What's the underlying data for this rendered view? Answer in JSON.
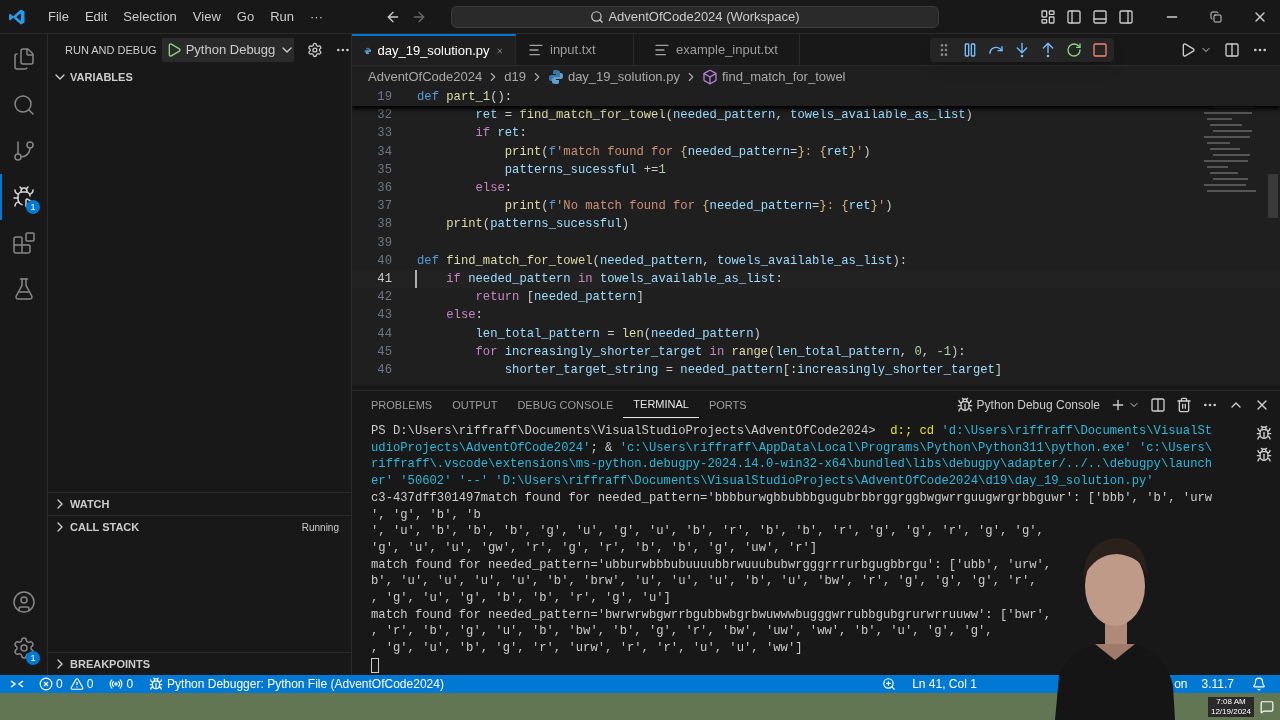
{
  "title_bar": {
    "menu": [
      "File",
      "Edit",
      "Selection",
      "View",
      "Go",
      "Run",
      "···"
    ],
    "search": "AdventOfCode2024 (Workspace)"
  },
  "activity_bar": [
    {
      "kind": "files",
      "selected": false
    },
    {
      "kind": "search",
      "selected": false
    },
    {
      "kind": "source",
      "selected": false
    },
    {
      "kind": "debug",
      "selected": true,
      "badge": "1"
    },
    {
      "kind": "extensions",
      "selected": false
    },
    {
      "kind": "testing",
      "selected": false
    }
  ],
  "activity_bottom": [
    {
      "kind": "account"
    },
    {
      "kind": "settings",
      "badge": "1"
    }
  ],
  "sidebar": {
    "title": "RUN AND DEBUG",
    "config": "Python Debugg",
    "sections": [
      {
        "label": "VARIABLES",
        "expanded": true
      },
      {
        "label": "WATCH",
        "expanded": false
      },
      {
        "label": "CALL STACK",
        "expanded": false,
        "status": "Running"
      },
      {
        "label": "BREAKPOINTS",
        "expanded": false
      }
    ]
  },
  "editor": {
    "tabs": [
      {
        "label": "day_19_solution.py",
        "kind": "python",
        "selected": true
      },
      {
        "label": "input.txt",
        "kind": "text",
        "selected": false
      },
      {
        "label": "example_input.txt",
        "kind": "text",
        "selected": false
      }
    ],
    "breadcrumbs": [
      {
        "label": "AdventOfCode2024",
        "kind": "folder"
      },
      {
        "label": "d19",
        "kind": "folder"
      },
      {
        "label": "day_19_solution.py",
        "kind": "python"
      },
      {
        "label": "find_match_for_towel",
        "kind": "symbol"
      }
    ],
    "sticky": {
      "number": "19",
      "tokens": [
        {
          "kind": "kw",
          "text": "def "
        },
        {
          "kind": "fn",
          "text": "part_1"
        },
        {
          "kind": "p",
          "text": "():"
        }
      ]
    },
    "lines": [
      {
        "number": "32",
        "current": false,
        "tokens": [
          {
            "kind": "var",
            "text": "        ret"
          },
          {
            "kind": "p",
            "text": " = "
          },
          {
            "kind": "fn",
            "text": "find_match_for_towel"
          },
          {
            "kind": "p",
            "text": "("
          },
          {
            "kind": "var",
            "text": "needed_pattern"
          },
          {
            "kind": "p",
            "text": ", "
          },
          {
            "kind": "var",
            "text": "towels_available_as_list"
          },
          {
            "kind": "p",
            "text": ")"
          }
        ]
      },
      {
        "number": "33",
        "current": false,
        "tokens": [
          {
            "kind": "ctl",
            "text": "        if "
          },
          {
            "kind": "var",
            "text": "ret"
          },
          {
            "kind": "p",
            "text": ":"
          }
        ]
      },
      {
        "number": "34",
        "current": false,
        "tokens": [
          {
            "kind": "fn",
            "text": "            print"
          },
          {
            "kind": "p",
            "text": "("
          },
          {
            "kind": "kw",
            "text": "f"
          },
          {
            "kind": "str",
            "text": "'match found for "
          },
          {
            "kind": "brace",
            "text": "{"
          },
          {
            "kind": "var",
            "text": "needed_pattern"
          },
          {
            "kind": "p",
            "text": "="
          },
          {
            "kind": "brace",
            "text": "}"
          },
          {
            "kind": "str",
            "text": ": "
          },
          {
            "kind": "brace",
            "text": "{"
          },
          {
            "kind": "var",
            "text": "ret"
          },
          {
            "kind": "brace",
            "text": "}"
          },
          {
            "kind": "str",
            "text": "'"
          },
          {
            "kind": "p",
            "text": ")"
          }
        ]
      },
      {
        "number": "35",
        "current": false,
        "tokens": [
          {
            "kind": "var",
            "text": "            patterns_sucessful"
          },
          {
            "kind": "p",
            "text": " +="
          },
          {
            "kind": "num",
            "text": "1"
          }
        ]
      },
      {
        "number": "36",
        "current": false,
        "tokens": [
          {
            "kind": "ctl",
            "text": "        else"
          },
          {
            "kind": "p",
            "text": ":"
          }
        ]
      },
      {
        "number": "37",
        "current": false,
        "tokens": [
          {
            "kind": "fn",
            "text": "            print"
          },
          {
            "kind": "p",
            "text": "("
          },
          {
            "kind": "kw",
            "text": "f"
          },
          {
            "kind": "str",
            "text": "'No match found for "
          },
          {
            "kind": "brace",
            "text": "{"
          },
          {
            "kind": "var",
            "text": "needed_pattern"
          },
          {
            "kind": "p",
            "text": "="
          },
          {
            "kind": "brace",
            "text": "}"
          },
          {
            "kind": "str",
            "text": ": "
          },
          {
            "kind": "brace",
            "text": "{"
          },
          {
            "kind": "var",
            "text": "ret"
          },
          {
            "kind": "brace",
            "text": "}"
          },
          {
            "kind": "str",
            "text": "'"
          },
          {
            "kind": "p",
            "text": ")"
          }
        ]
      },
      {
        "number": "38",
        "current": false,
        "tokens": [
          {
            "kind": "fn",
            "text": "    print"
          },
          {
            "kind": "p",
            "text": "("
          },
          {
            "kind": "var",
            "text": "patterns_sucessful"
          },
          {
            "kind": "p",
            "text": ")"
          }
        ]
      },
      {
        "number": "39",
        "current": false
      },
      {
        "number": "40",
        "current": false,
        "tokens": [
          {
            "kind": "kw",
            "text": "def "
          },
          {
            "kind": "fn",
            "text": "find_match_for_towel"
          },
          {
            "kind": "p",
            "text": "("
          },
          {
            "kind": "var",
            "text": "needed_pattern"
          },
          {
            "kind": "p",
            "text": ", "
          },
          {
            "kind": "var",
            "text": "towels_available_as_list"
          },
          {
            "kind": "p",
            "text": "):"
          }
        ]
      },
      {
        "number": "41",
        "current": true,
        "tokens": [
          {
            "kind": "ctl",
            "text": "    if "
          },
          {
            "kind": "var",
            "text": "needed_pattern"
          },
          {
            "kind": "ctl",
            "text": " in "
          },
          {
            "kind": "var",
            "text": "towels_available_as_list"
          },
          {
            "kind": "p",
            "text": ":"
          }
        ]
      },
      {
        "number": "42",
        "current": false,
        "tokens": [
          {
            "kind": "ctl",
            "text": "        return "
          },
          {
            "kind": "p",
            "text": "["
          },
          {
            "kind": "var",
            "text": "needed_pattern"
          },
          {
            "kind": "p",
            "text": "]"
          }
        ]
      },
      {
        "number": "43",
        "current": false,
        "tokens": [
          {
            "kind": "ctl",
            "text": "    else"
          },
          {
            "kind": "p",
            "text": ":"
          }
        ]
      },
      {
        "number": "44",
        "current": false,
        "tokens": [
          {
            "kind": "var",
            "text": "        len_total_pattern"
          },
          {
            "kind": "p",
            "text": " = "
          },
          {
            "kind": "fn",
            "text": "len"
          },
          {
            "kind": "p",
            "text": "("
          },
          {
            "kind": "var",
            "text": "needed_pattern"
          },
          {
            "kind": "p",
            "text": ")"
          }
        ]
      },
      {
        "number": "45",
        "current": false,
        "tokens": [
          {
            "kind": "ctl",
            "text": "        for "
          },
          {
            "kind": "var",
            "text": "increasingly_shorter_target"
          },
          {
            "kind": "ctl",
            "text": " in "
          },
          {
            "kind": "fn",
            "text": "range"
          },
          {
            "kind": "p",
            "text": "("
          },
          {
            "kind": "var",
            "text": "len_total_pattern"
          },
          {
            "kind": "p",
            "text": ", "
          },
          {
            "kind": "num",
            "text": "0"
          },
          {
            "kind": "p",
            "text": ", "
          },
          {
            "kind": "num",
            "text": "-1"
          },
          {
            "kind": "p",
            "text": "):"
          }
        ]
      },
      {
        "number": "46",
        "current": false,
        "tokens": [
          {
            "kind": "var",
            "text": "            shorter_target_string"
          },
          {
            "kind": "p",
            "text": " = "
          },
          {
            "kind": "var",
            "text": "needed_pattern"
          },
          {
            "kind": "p",
            "text": "[:"
          },
          {
            "kind": "var",
            "text": "increasingly_shorter_target"
          },
          {
            "kind": "p",
            "text": "]"
          }
        ]
      }
    ]
  },
  "panel": {
    "tabs": [
      {
        "label": "PROBLEMS",
        "selected": false
      },
      {
        "label": "OUTPUT",
        "selected": false
      },
      {
        "label": "DEBUG CONSOLE",
        "selected": false
      },
      {
        "label": "TERMINAL",
        "selected": true
      },
      {
        "label": "PORTS",
        "selected": false
      }
    ],
    "terminal_name": "Python Debug Console",
    "lines": [
      [
        {
          "kind": "p",
          "text": "PS D:\\Users\\riffraff\\Documents\\VisualStudioProjects\\AdventOfCode2024>  "
        },
        {
          "kind": "cmd",
          "text": "d:;"
        },
        {
          "kind": "cmd",
          "text": " cd"
        },
        {
          "kind": "str",
          "text": " 'd:\\Users\\riffraff\\Documents\\VisualSt"
        }
      ],
      [
        {
          "kind": "str",
          "text": "udioProjects\\AdventOfCode2024'"
        },
        {
          "kind": "p",
          "text": "; & "
        },
        {
          "kind": "str",
          "text": "'c:\\Users\\riffraff\\AppData\\Local\\Programs\\Python\\Python311\\python.exe'"
        },
        {
          "kind": "str",
          "text": " 'c:\\Users\\"
        }
      ],
      [
        {
          "kind": "str",
          "text": "riffraff\\.vscode\\extensions\\ms-python.debugpy-2024.14.0-win32-x64\\bundled\\libs\\debugpy\\adapter/../..\\debugpy\\launch"
        }
      ],
      [
        {
          "kind": "str",
          "text": "er'"
        },
        {
          "kind": "str",
          "text": " '50602'"
        },
        {
          "kind": "str",
          "text": " '--'"
        },
        {
          "kind": "str",
          "text": " 'D:\\Users\\riffraff\\Documents\\VisualStudioProjects\\AdventOfCode2024\\d19\\day_19_solution.py'"
        }
      ],
      [
        {
          "kind": "p",
          "text": "c3-437dff301497match found for needed_pattern='bbbburwgbbubbbgugubrbbrggrggbwgwrrguugwrgrbbguwr': ['bbb', 'b', 'urw"
        }
      ],
      [
        {
          "kind": "p",
          "text": "', 'g', 'b', 'b"
        }
      ],
      [
        {
          "kind": "p",
          "text": "', 'u', 'b', 'b', 'b', 'g', 'u', 'g', 'u', 'b', 'r', 'b', 'b', 'r', 'g', 'g', 'r', 'g', 'g',"
        }
      ],
      [
        {
          "kind": "p",
          "text": "'g', 'u', 'u', 'gw', 'r', 'g', 'r', 'b', 'b', 'g', 'uw', 'r']"
        }
      ],
      [
        {
          "kind": "p",
          "text": "match found for needed_pattern='ubburwbbbubuuuubbrwuuububwrgggrrrurbgugbbrgu': ['ubb', 'urw',"
        }
      ],
      [
        {
          "kind": "p",
          "text": "b', 'u', 'u', 'u', 'u', 'b', 'brw', 'u', 'u', 'u', 'b', 'u', 'bw', 'r', 'g', 'g', 'g', 'r',"
        }
      ],
      [
        {
          "kind": "p",
          "text": ", 'g', 'u', 'g', 'b', 'b', 'r', 'g', 'u']"
        }
      ],
      [
        {
          "kind": "p",
          "text": "match found for needed_pattern='bwrwrwbgwrrbgubbwbgrbwuwwwbugggwrrubbgubgrurwrruuww': ['bwr',"
        }
      ],
      [
        {
          "kind": "p",
          "text": ", 'r', 'b', 'g', 'u', 'b', 'bw', 'b', 'g', 'r', 'bw', 'uw', 'ww', 'b', 'u', 'g', 'g',"
        }
      ],
      [
        {
          "kind": "p",
          "text": ", 'g', 'u', 'b', 'g', 'r', 'urw', 'r', 'r', 'u', 'u', 'ww']"
        }
      ]
    ]
  },
  "status_bar": {
    "errors": "0",
    "warnings": "0",
    "ports": "0",
    "debug": "Python Debugger: Python File (AdventOfCode2024)",
    "position": "Ln 41, Col 1",
    "language": "on",
    "python_version": "3.11.7"
  },
  "taskbar": {
    "time": "7:08 AM",
    "date": "12/19/2024"
  }
}
